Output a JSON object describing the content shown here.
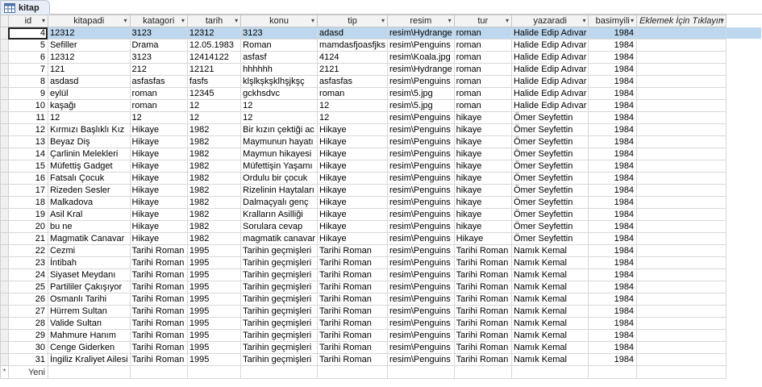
{
  "tab": {
    "title": "kitap",
    "icon": "table-icon"
  },
  "columns": [
    "id",
    "kitapadi",
    "katagori",
    "tarih",
    "konu",
    "tip",
    "resim",
    "tur",
    "yazaradi",
    "basimyili"
  ],
  "add_column_label": "Eklemek İçin Tıklayın",
  "new_row": {
    "marker": "*",
    "label": "Yeni"
  },
  "rows": [
    [
      "4",
      "12312",
      "3123",
      "12312",
      "3123",
      "adasd",
      "resim\\Hydrange",
      "roman",
      "Halide Edip Adıvar",
      "1984"
    ],
    [
      "5",
      "Sefiller",
      "Drama",
      "12.05.1983",
      "Roman",
      "mamdasfjoasfjks",
      "resim\\Penguins",
      "roman",
      "Halide Edip Adıvar",
      "1984"
    ],
    [
      "6",
      "12312",
      "3123",
      "12414122",
      "asfasf",
      "4124",
      "resim\\Koala.jpg",
      "roman",
      "Halide Edip Adıvar",
      "1984"
    ],
    [
      "7",
      "121",
      "212",
      "12121",
      "hhhhhh",
      "2121",
      "resim\\Hydrange",
      "roman",
      "Halide Edip Adıvar",
      "1984"
    ],
    [
      "8",
      "asdasd",
      "asfasfas",
      "fasfs",
      "klşlkşkşklhşjkşç",
      "asfasfas",
      "resim\\Penguins",
      "roman",
      "Halide Edip Adıvar",
      "1984"
    ],
    [
      "9",
      "eylül",
      "roman",
      "12345",
      "gckhsdvc",
      "roman",
      "resim\\5.jpg",
      "roman",
      "Halide Edip Adıvar",
      "1984"
    ],
    [
      "10",
      "kaşağı",
      "roman",
      "12",
      "12",
      "12",
      "resim\\5.jpg",
      "roman",
      "Halide Edip Adıvar",
      "1984"
    ],
    [
      "11",
      "12",
      "12",
      "12",
      "12",
      "12",
      "resim\\Penguins",
      "hikaye",
      "Ömer Seyfettin",
      "1984"
    ],
    [
      "12",
      "Kırmızı Başlıklı Kız",
      "Hikaye",
      "1982",
      "Bir kızın çektiği ac",
      "Hikaye",
      "resim\\Penguins",
      "hikaye",
      "Ömer Seyfettin",
      "1984"
    ],
    [
      "13",
      "Beyaz Diş",
      "Hikaye",
      "1982",
      "Maymunun hayatı",
      "Hikaye",
      "resim\\Penguins",
      "hikaye",
      "Ömer Seyfettin",
      "1984"
    ],
    [
      "14",
      "Çarlinin Melekleri",
      "Hikaye",
      "1982",
      "Maymun hikayesi",
      "Hikaye",
      "resim\\Penguins",
      "hikaye",
      "Ömer Seyfettin",
      "1984"
    ],
    [
      "15",
      "Müfettiş Gadget",
      "Hikaye",
      "1982",
      "Müfettişin Yaşamı",
      "Hikaye",
      "resim\\Penguins",
      "hikaye",
      "Ömer Seyfettin",
      "1984"
    ],
    [
      "16",
      "Fatsalı Çocuk",
      "Hikaye",
      "1982",
      "Ordulu bir çocuk",
      "Hikaye",
      "resim\\Penguins",
      "hikaye",
      "Ömer Seyfettin",
      "1984"
    ],
    [
      "17",
      "Rizeden Sesler",
      "Hikaye",
      "1982",
      "Rizelinin Haytaları",
      "Hikaye",
      "resim\\Penguins",
      "hikaye",
      "Ömer Seyfettin",
      "1984"
    ],
    [
      "18",
      "Malkadova",
      "Hikaye",
      "1982",
      "Dalmaçyalı genç",
      "Hikaye",
      "resim\\Penguins",
      "hikaye",
      "Ömer Seyfettin",
      "1984"
    ],
    [
      "19",
      "Asil Kral",
      "Hikaye",
      "1982",
      "Kralların Asilliği",
      "Hikaye",
      "resim\\Penguins",
      "hikaye",
      "Ömer Seyfettin",
      "1984"
    ],
    [
      "20",
      "bu ne",
      "Hikaye",
      "1982",
      "Sorulara cevap",
      "Hikaye",
      "resim\\Penguins",
      "hikaye",
      "Ömer Seyfettin",
      "1984"
    ],
    [
      "21",
      "Magmatik Canavar",
      "Hikaye",
      "1982",
      "magmatik canavar",
      "Hikaye",
      "resim\\Penguins",
      "Hikaye",
      "Ömer Seyfettin",
      "1984"
    ],
    [
      "22",
      "Cezmi",
      "Tarihi Roman",
      "1995",
      "Tarihin geçmişleri",
      "Tarihi Roman",
      "resim\\Penguins",
      "Tarihi Roman",
      "Namık Kemal",
      "1984"
    ],
    [
      "23",
      "İntibah",
      "Tarihi Roman",
      "1995",
      "Tarihin geçmişleri",
      "Tarihi Roman",
      "resim\\Penguins",
      "Tarihi Roman",
      "Namık Kemal",
      "1984"
    ],
    [
      "24",
      "Siyaset Meydanı",
      "Tarihi Roman",
      "1995",
      "Tarihin geçmişleri",
      "Tarihi Roman",
      "resim\\Penguins",
      "Tarihi Roman",
      "Namık Kemal",
      "1984"
    ],
    [
      "25",
      "Partililer Çakışıyor",
      "Tarihi Roman",
      "1995",
      "Tarihin geçmişleri",
      "Tarihi Roman",
      "resim\\Penguins",
      "Tarihi Roman",
      "Namık Kemal",
      "1984"
    ],
    [
      "26",
      "Osmanlı Tarihi",
      "Tarihi Roman",
      "1995",
      "Tarihin geçmişleri",
      "Tarihi Roman",
      "resim\\Penguins",
      "Tarihi Roman",
      "Namık Kemal",
      "1984"
    ],
    [
      "27",
      "Hürrem Sultan",
      "Tarihi Roman",
      "1995",
      "Tarihin geçmişleri",
      "Tarihi Roman",
      "resim\\Penguins",
      "Tarihi Roman",
      "Namık Kemal",
      "1984"
    ],
    [
      "28",
      "Valide Sultan",
      "Tarihi Roman",
      "1995",
      "Tarihin geçmişleri",
      "Tarihi Roman",
      "resim\\Penguins",
      "Tarihi Roman",
      "Namık Kemal",
      "1984"
    ],
    [
      "29",
      "Mahmure Hanım",
      "Tarihi Roman",
      "1995",
      "Tarihin geçmişleri",
      "Tarihi Roman",
      "resim\\Penguins",
      "Tarihi Roman",
      "Namık Kemal",
      "1984"
    ],
    [
      "30",
      "Cenge Giderken",
      "Tarihi Roman",
      "1995",
      "Tarihin geçmişleri",
      "Tarihi Roman",
      "resim\\Penguins",
      "Tarihi Roman",
      "Namık Kemal",
      "1984"
    ],
    [
      "31",
      "İngiliz Kraliyet Ailesi",
      "Tarihi Roman",
      "1995",
      "Tarihin geçmişleri",
      "Tarihi Roman",
      "resim\\Penguins",
      "Tarihi Roman",
      "Namık Kemal",
      "1984"
    ]
  ]
}
